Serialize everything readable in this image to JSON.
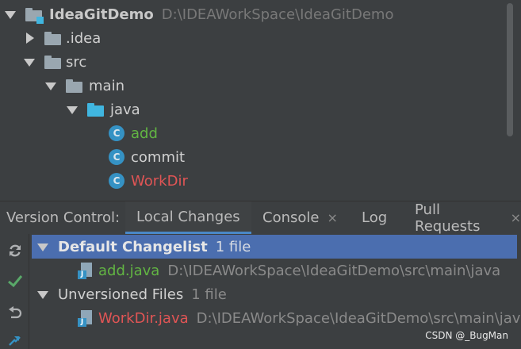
{
  "project_tree": {
    "root": {
      "name": "IdeaGitDemo",
      "path": "D:\\IDEAWorkSpace\\IdeaGitDemo"
    },
    "idea_folder": ".idea",
    "src_folder": "src",
    "main_folder": "main",
    "java_folder": "java",
    "class_icon_letter": "C",
    "files": [
      {
        "name": "add",
        "status": "added",
        "color": "#62b543"
      },
      {
        "name": "commit",
        "status": "unchanged",
        "color": "#d0d0d0"
      },
      {
        "name": "WorkDir",
        "status": "unversioned",
        "color": "#e05555"
      }
    ]
  },
  "tool_window": {
    "title": "Version Control:",
    "tabs": [
      {
        "label": "Local Changes",
        "active": true
      },
      {
        "label": "Console",
        "active": false,
        "closable": true
      },
      {
        "label": "Log",
        "active": false
      },
      {
        "label": "Pull Requests",
        "active": false,
        "closable": true
      }
    ],
    "close_glyph": "×"
  },
  "toolbar": {
    "icons": [
      "refresh-icon",
      "commit-check-icon",
      "rollback-icon",
      "diff-icon"
    ]
  },
  "changes": {
    "default_changelist": {
      "label": "Default Changelist",
      "count": "1 file"
    },
    "default_files": [
      {
        "name": "add.java",
        "path": "D:\\IDEAWorkSpace\\IdeaGitDemo\\src\\main\\java",
        "color": "#62b543"
      }
    ],
    "unversioned": {
      "label": "Unversioned Files",
      "count": "1 file"
    },
    "unversioned_files": [
      {
        "name": "WorkDir.java",
        "path": "D:\\IDEAWorkSpace\\IdeaGitDemo\\src\\main\\java",
        "color": "#e05555"
      }
    ],
    "java_badge": "J"
  },
  "watermark": "CSDN @_BugMan",
  "colors": {
    "background": "#3c3f41",
    "selection": "#4b6eaf",
    "tab_underline": "#4a88c7",
    "added": "#62b543",
    "unversioned": "#e05555"
  }
}
